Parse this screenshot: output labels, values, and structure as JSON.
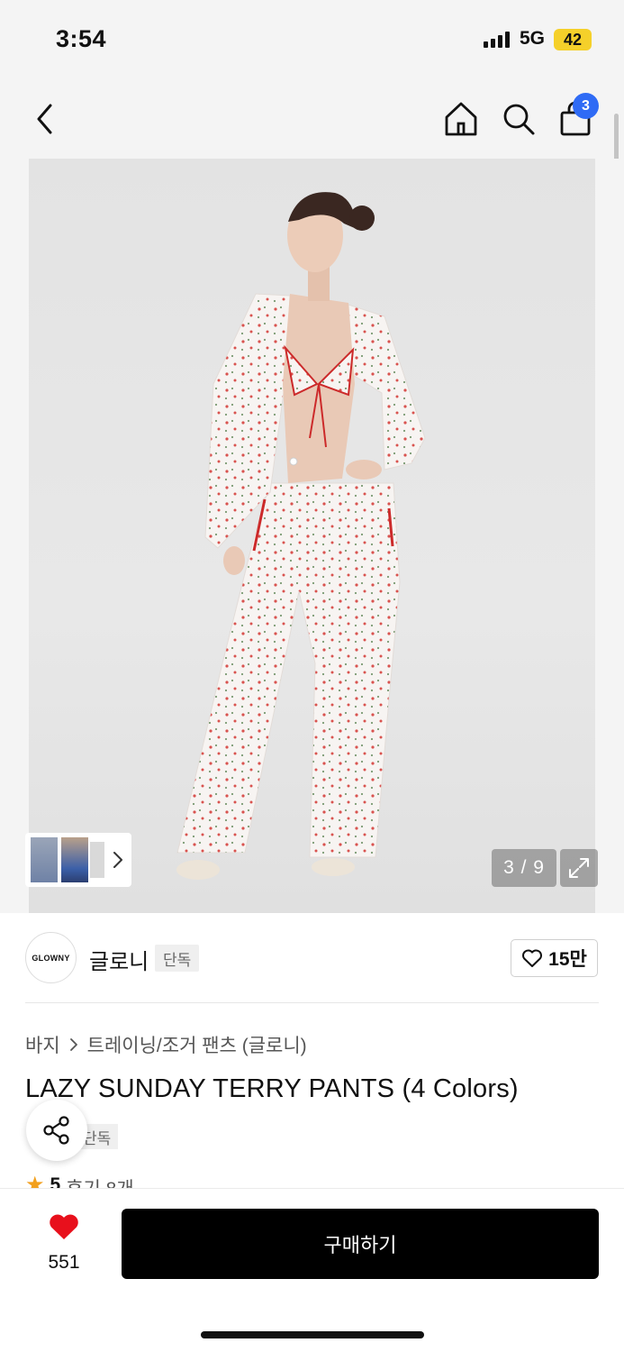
{
  "status_bar": {
    "time": "3:54",
    "network": "5G",
    "battery": "42"
  },
  "nav": {
    "cart_count": "3"
  },
  "gallery": {
    "counter": "3 / 9"
  },
  "brand": {
    "logo_text": "GLOWNY",
    "name": "글로니",
    "tag": "단독",
    "likes": "15만"
  },
  "product": {
    "breadcrumb": [
      "바지",
      "트레이닝/조거 팬츠 (글로니)"
    ],
    "title": "LAZY SUNDAY TERRY PANTS (4 Colors)",
    "tag": "단독",
    "rating": "5",
    "review_text": "후기 8개"
  },
  "bottom_bar": {
    "wish_count": "551",
    "buy_label": "구매하기"
  },
  "colors": {
    "badge_blue": "#2f6bf5",
    "heart_red": "#e8101c",
    "star_orange": "#f2a01e",
    "buy_black": "#000000"
  }
}
